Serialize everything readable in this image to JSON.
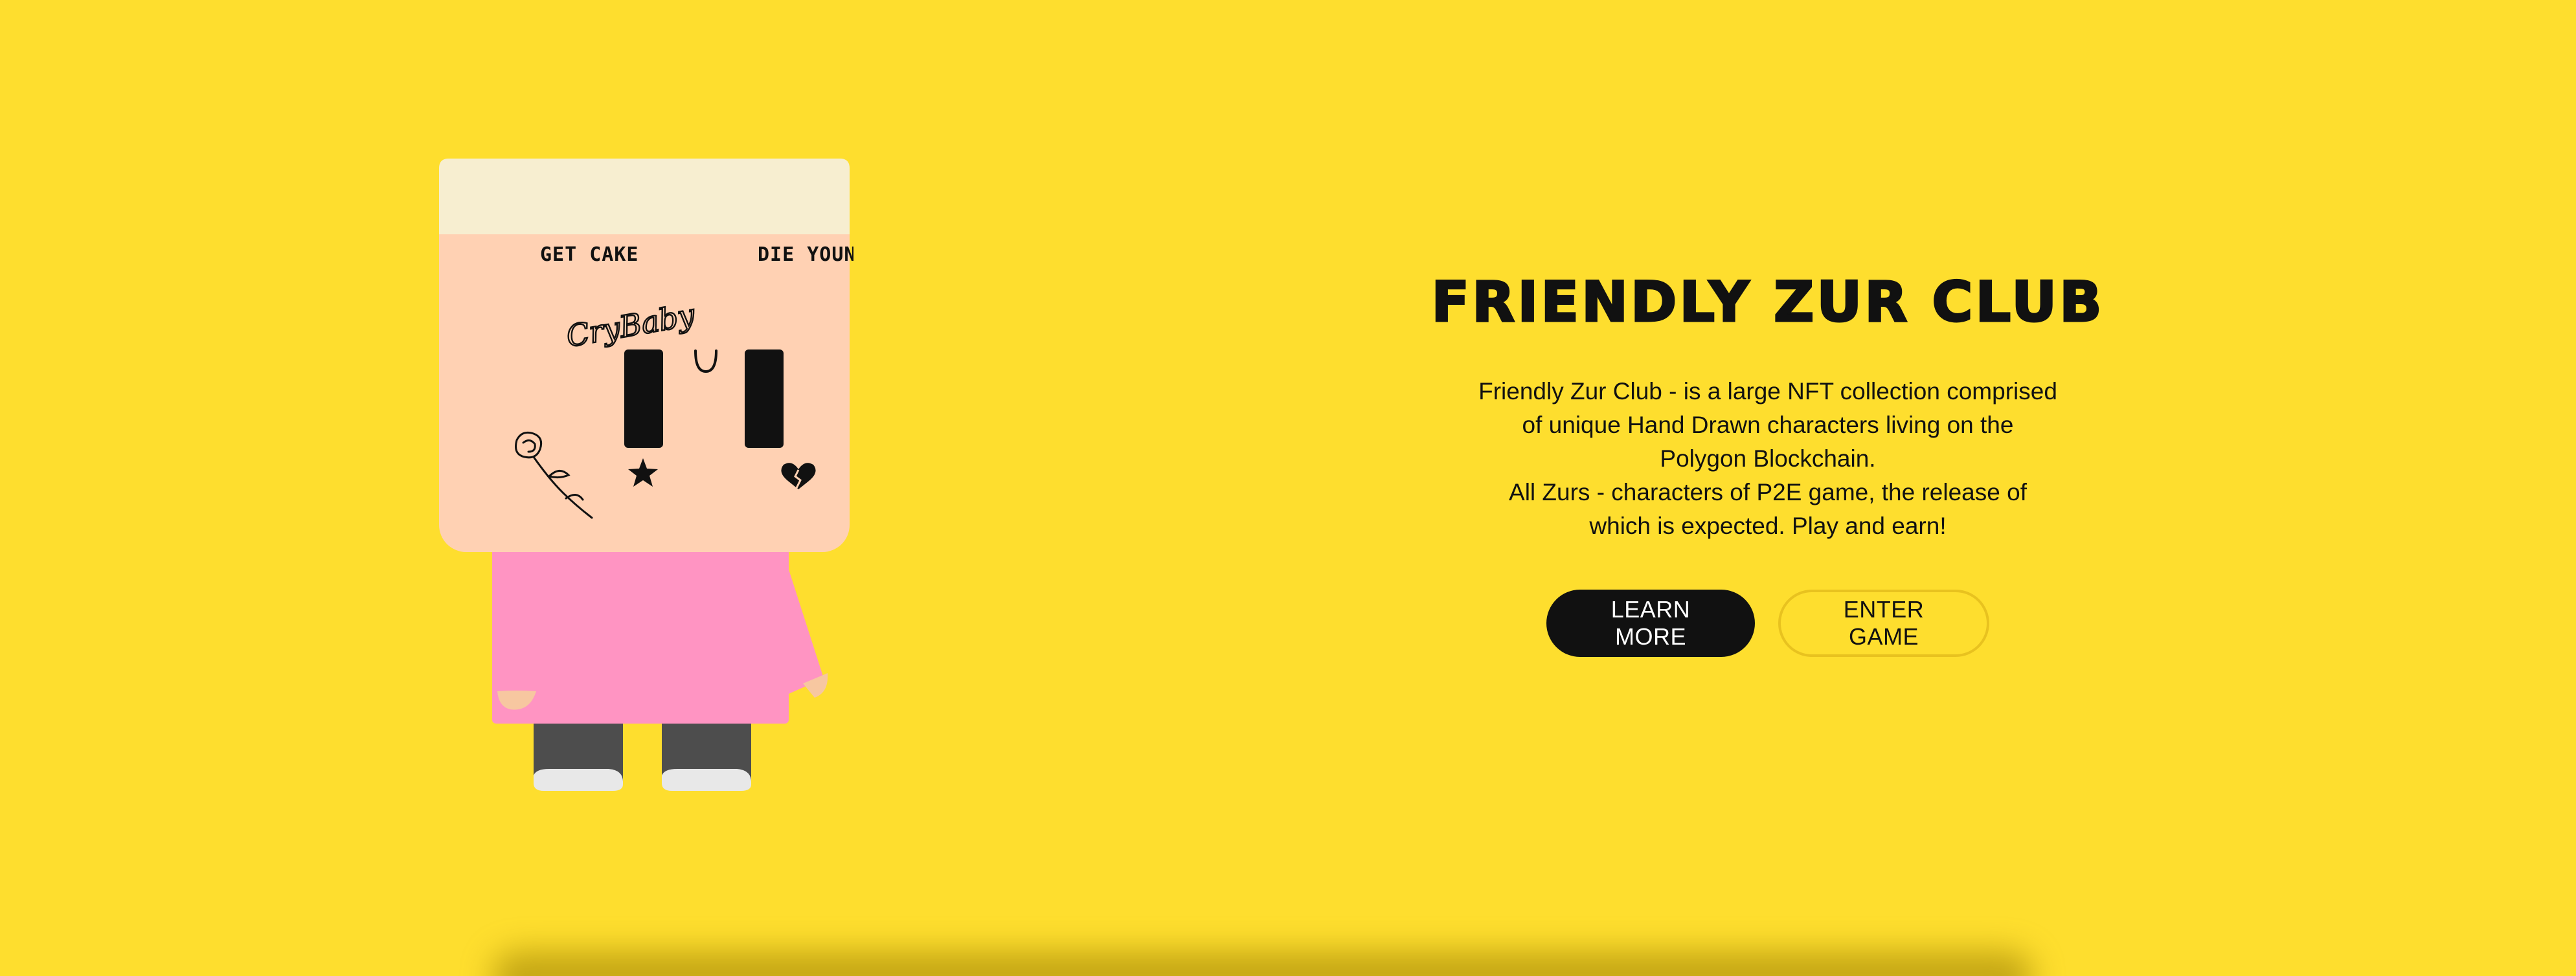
{
  "hero": {
    "title": "FRIENDLY ZUR CLUB",
    "description_line_1": "Friendly Zur Club - is a large NFT collection comprised of unique Hand Drawn characters living on the Polygon Blockchain.",
    "description_line_2": "All Zurs - characters of P2E game, the release of which is expected. Play and earn!",
    "buttons": {
      "learn_more": "LEARN MORE",
      "enter_game": "ENTER GAME"
    }
  },
  "character": {
    "tattoo_left": "GET CAKE",
    "tattoo_right": "DIE YOUNG",
    "tattoo_script": "CryBaby",
    "icons": [
      "rose-tattoo-icon",
      "star-tattoo-icon",
      "heart-tattoo-icon"
    ]
  },
  "colors": {
    "background": "#FEDE2E",
    "text": "#111111",
    "button_primary_bg": "#111111",
    "button_outline_border": "#E8C21F",
    "head_skin": "#FFD1B3",
    "headband": "#F7EED0",
    "shirt": "#FF94C2",
    "legs": "#4D4D4D",
    "shoes": "#E8E8E8"
  }
}
